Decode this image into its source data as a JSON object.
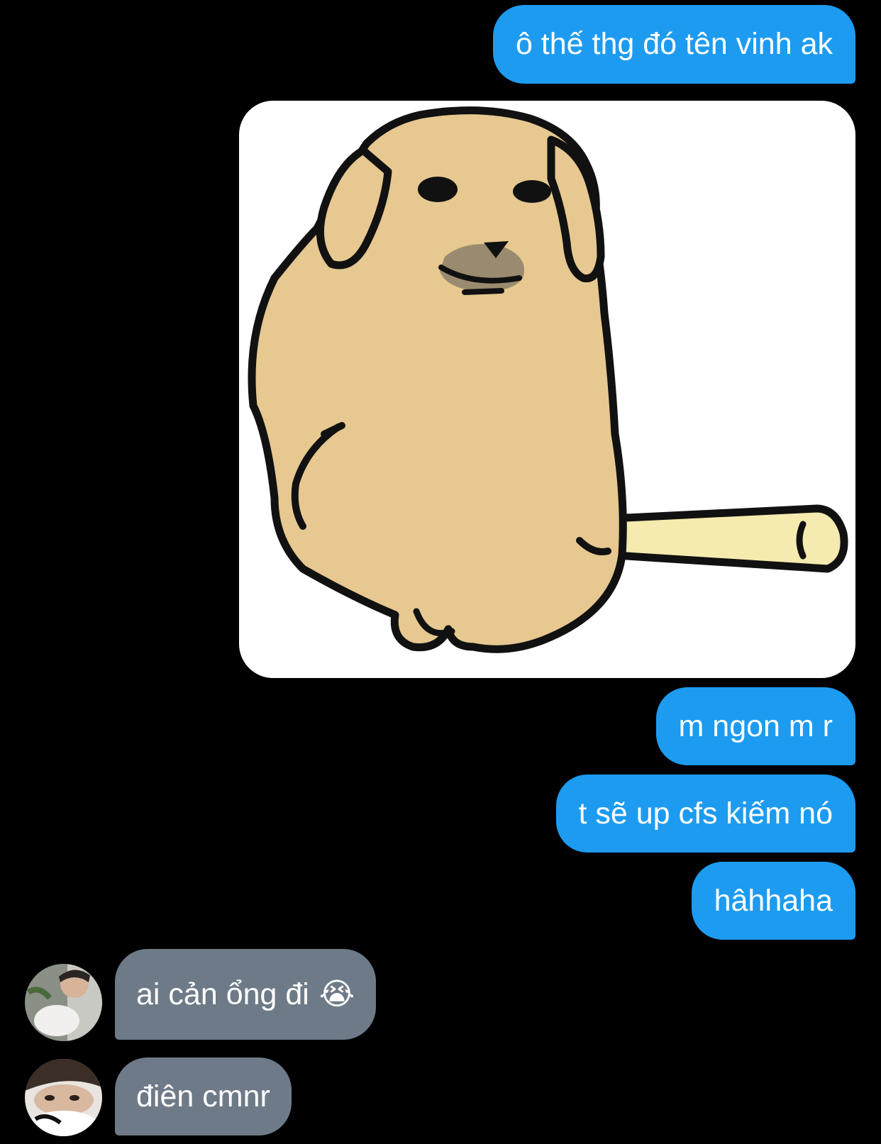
{
  "colors": {
    "outgoing_bubble": "#1d9bf0",
    "incoming_bubble": "#6e7a87",
    "background": "#000000",
    "text": "#ffffff"
  },
  "messages": [
    {
      "direction": "outgoing",
      "kind": "text",
      "text": "ô thế thg đó tên vinh ak"
    },
    {
      "direction": "outgoing",
      "kind": "sticker",
      "icon": "dog-with-bat-sticker"
    },
    {
      "direction": "outgoing",
      "kind": "text",
      "text": "m ngon m r"
    },
    {
      "direction": "outgoing",
      "kind": "text",
      "text": "t sẽ up cfs kiếm nó"
    },
    {
      "direction": "outgoing",
      "kind": "text",
      "text": "hâhhaha"
    },
    {
      "direction": "incoming",
      "kind": "text",
      "text": "ai cản ổng đi",
      "emoji": "😭",
      "avatar": "user-avatar-1"
    },
    {
      "direction": "incoming",
      "kind": "text",
      "text": "điên cmnr",
      "avatar": "user-avatar-2"
    }
  ]
}
